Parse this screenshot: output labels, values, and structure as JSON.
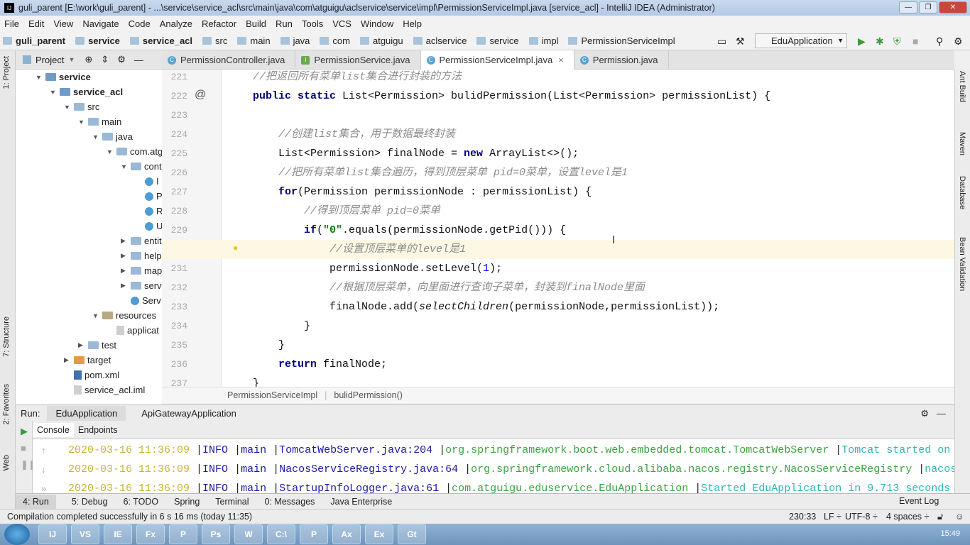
{
  "window": {
    "title": "guli_parent [E:\\work\\guli_parent] - ...\\service\\service_acl\\src\\main\\java\\com\\atguigu\\aclservice\\service\\impl\\PermissionServiceImpl.java [service_acl] - IntelliJ IDEA (Administrator)",
    "controls": [
      "—",
      "❐",
      "✕"
    ]
  },
  "menu": [
    "File",
    "Edit",
    "View",
    "Navigate",
    "Code",
    "Analyze",
    "Refactor",
    "Build",
    "Run",
    "Tools",
    "VCS",
    "Window",
    "Help"
  ],
  "navbar": {
    "crumbs": [
      "guli_parent",
      "service",
      "service_acl",
      "src",
      "main",
      "java",
      "com",
      "atguigu",
      "aclservice",
      "service",
      "impl",
      "PermissionServiceImpl"
    ],
    "run_config": "EduApplication"
  },
  "project_panel": {
    "title": "Project"
  },
  "left_stripe": [
    "1: Project",
    "7: Structure",
    "2: Favorites",
    "Web"
  ],
  "right_stripe": [
    "Ant Build",
    "Maven",
    "Database",
    "Bean Validation"
  ],
  "tabs": [
    {
      "label": "PermissionController.java",
      "kind": "class",
      "active": false
    },
    {
      "label": "PermissionService.java",
      "kind": "interface",
      "active": false
    },
    {
      "label": "PermissionServiceImpl.java",
      "kind": "class",
      "active": true
    },
    {
      "label": "Permission.java",
      "kind": "class",
      "active": false
    }
  ],
  "tree": [
    {
      "label": "service",
      "depth": 0,
      "arrow": "▼",
      "icon": "module",
      "bold": true
    },
    {
      "label": "service_acl",
      "depth": 1,
      "arrow": "▼",
      "icon": "module",
      "bold": true
    },
    {
      "label": "src",
      "depth": 2,
      "arrow": "▼",
      "icon": "folder"
    },
    {
      "label": "main",
      "depth": 3,
      "arrow": "▼",
      "icon": "folder"
    },
    {
      "label": "java",
      "depth": 4,
      "arrow": "▼",
      "icon": "folder"
    },
    {
      "label": "com.atg",
      "depth": 5,
      "arrow": "▼",
      "icon": "folder"
    },
    {
      "label": "cont",
      "depth": 6,
      "arrow": "▼",
      "icon": "folder"
    },
    {
      "label": "I",
      "depth": 7,
      "arrow": "",
      "icon": "class"
    },
    {
      "label": "P",
      "depth": 7,
      "arrow": "",
      "icon": "class"
    },
    {
      "label": "R",
      "depth": 7,
      "arrow": "",
      "icon": "class"
    },
    {
      "label": "U",
      "depth": 7,
      "arrow": "",
      "icon": "class"
    },
    {
      "label": "entit",
      "depth": 6,
      "arrow": "▶",
      "icon": "folder"
    },
    {
      "label": "help",
      "depth": 6,
      "arrow": "▶",
      "icon": "folder"
    },
    {
      "label": "map",
      "depth": 6,
      "arrow": "▶",
      "icon": "folder"
    },
    {
      "label": "serv",
      "depth": 6,
      "arrow": "▶",
      "icon": "folder"
    },
    {
      "label": "Serv",
      "depth": 6,
      "arrow": "",
      "icon": "class"
    },
    {
      "label": "resources",
      "depth": 4,
      "arrow": "▼",
      "icon": "resources"
    },
    {
      "label": "applicat",
      "depth": 5,
      "arrow": "",
      "icon": "file"
    },
    {
      "label": "test",
      "depth": 3,
      "arrow": "▶",
      "icon": "folder"
    },
    {
      "label": "target",
      "depth": 2,
      "arrow": "▶",
      "icon": "target"
    },
    {
      "label": "pom.xml",
      "depth": 2,
      "arrow": "",
      "icon": "maven"
    },
    {
      "label": "service_acl.iml",
      "depth": 2,
      "arrow": "",
      "icon": "file"
    }
  ],
  "code": [
    {
      "n": "221",
      "indent": 0,
      "tokens": [
        [
          "cm",
          "//把返回所有菜单list集合进行封装的方法"
        ]
      ]
    },
    {
      "n": "222",
      "indent": 0,
      "marker": "@",
      "tokens": [
        [
          "kw",
          "public static "
        ],
        [
          "",
          "List<Permission> bulidPermission(List<Permission> permissionList) {"
        ]
      ]
    },
    {
      "n": "223",
      "indent": 0,
      "tokens": []
    },
    {
      "n": "224",
      "indent": 1,
      "tokens": [
        [
          "cm",
          "//创建list集合，用于数据最终封装"
        ]
      ]
    },
    {
      "n": "225",
      "indent": 1,
      "tokens": [
        [
          "",
          "List<Permission> finalNode = "
        ],
        [
          "kw",
          "new "
        ],
        [
          "",
          "ArrayList<>();"
        ]
      ]
    },
    {
      "n": "226",
      "indent": 1,
      "tokens": [
        [
          "cm",
          "//把所有菜单list集合遍历，得到顶层菜单 pid=0菜单，设置level是1"
        ]
      ]
    },
    {
      "n": "227",
      "indent": 1,
      "tokens": [
        [
          "kw",
          "for"
        ],
        [
          "",
          "(Permission permissionNode : permissionList) {"
        ]
      ]
    },
    {
      "n": "228",
      "indent": 2,
      "tokens": [
        [
          "cm",
          "//得到顶层菜单 pid=0菜单"
        ]
      ]
    },
    {
      "n": "229",
      "indent": 2,
      "tokens": [
        [
          "kw",
          "if"
        ],
        [
          "",
          "("
        ],
        [
          "str",
          "\"0\""
        ],
        [
          "",
          ".equals(permissionNode.getPid())) {"
        ]
      ]
    },
    {
      "n": "230",
      "indent": 3,
      "highlight": true,
      "bulb": true,
      "tokens": [
        [
          "cm",
          "//设置顶层菜单的level是1"
        ]
      ]
    },
    {
      "n": "231",
      "indent": 3,
      "tokens": [
        [
          "",
          "permissionNode.setLevel("
        ],
        [
          "num",
          "1"
        ],
        [
          "",
          ");"
        ]
      ]
    },
    {
      "n": "232",
      "indent": 3,
      "tokens": [
        [
          "cm",
          "//根据顶层菜单，向里面进行查询子菜单，封装到finalNode里面"
        ]
      ]
    },
    {
      "n": "233",
      "indent": 3,
      "tokens": [
        [
          "",
          "finalNode.add("
        ],
        [
          "it",
          "selectChildren"
        ],
        [
          "",
          "(permissionNode,permissionList));"
        ]
      ]
    },
    {
      "n": "234",
      "indent": 2,
      "tokens": [
        [
          "",
          "}"
        ]
      ]
    },
    {
      "n": "235",
      "indent": 1,
      "tokens": [
        [
          "",
          "}"
        ]
      ]
    },
    {
      "n": "236",
      "indent": 1,
      "tokens": [
        [
          "kw",
          "return "
        ],
        [
          "",
          "finalNode;"
        ]
      ]
    },
    {
      "n": "237",
      "indent": 0,
      "tokens": [
        [
          "",
          "}"
        ]
      ]
    }
  ],
  "editor_breadcrumb": [
    "PermissionServiceImpl",
    "bulidPermission()"
  ],
  "run_panel": {
    "label": "Run:",
    "tabs": [
      "EduApplication",
      "ApiGatewayApplication"
    ],
    "subtabs": [
      "Console",
      "Endpoints"
    ]
  },
  "console": [
    {
      "ts": "2020-03-16 11:36:09",
      "level": "INFO",
      "thread": "main",
      "logger": "TomcatWebServer.java:204",
      "pkg": "org.springframework.boot.web.embedded.tomcat.TomcatWebServer",
      "msg": "Tomcat started on"
    },
    {
      "ts": "2020-03-16 11:36:09",
      "level": "INFO",
      "thread": "main",
      "logger": "NacosServiceRegistry.java:64",
      "pkg": "org.springframework.cloud.alibaba.nacos.registry.NacosServiceRegistry",
      "msg": "nacos"
    },
    {
      "ts": "2020-03-16 11:36:09",
      "level": "INFO",
      "thread": "main",
      "logger": "StartupInfoLogger.java:61",
      "pkg": "com.atguigu.eduservice.EduApplication",
      "msg": "Started EduApplication in 9.713 seconds"
    }
  ],
  "bottom_tabs": [
    "4: Run",
    "5: Debug",
    "6: TODO",
    "Spring",
    "Terminal",
    "0: Messages",
    "Java Enterprise"
  ],
  "event_log": "Event Log",
  "status": {
    "message": "Compilation completed successfully in 6 s 16 ms (today 11:35)",
    "position": "230:33",
    "line_sep": "LF ÷",
    "encoding": "UTF-8 ÷",
    "indent": "4 spaces ÷"
  },
  "taskbar": {
    "apps": [
      "IJ",
      "VS",
      "IE",
      "Fx",
      "P",
      "Ps",
      "W",
      "C:\\",
      "P",
      "Ax",
      "Ex",
      "Gt"
    ],
    "clock": "15:49"
  }
}
